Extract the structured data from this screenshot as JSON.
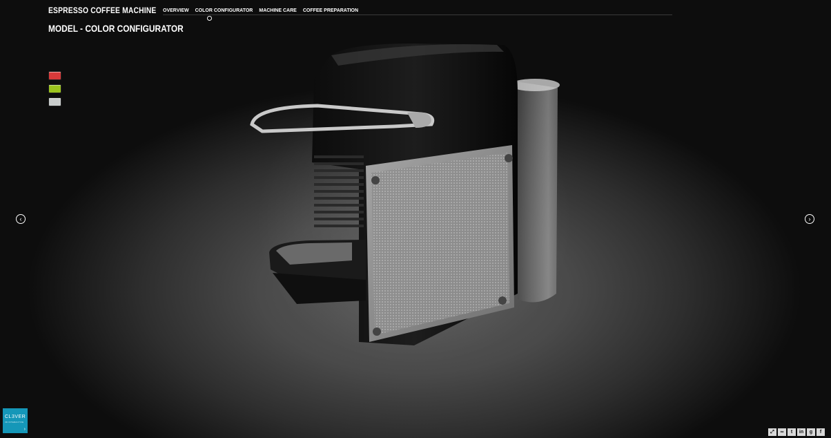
{
  "app": {
    "title": "ESPRESSO COFFEE MACHINE"
  },
  "nav": {
    "items": [
      {
        "label": "OVERVIEW",
        "active": false
      },
      {
        "label": "COLOR CONFIGURATOR",
        "active": true
      },
      {
        "label": "MACHINE CARE",
        "active": false
      },
      {
        "label": "COFFEE PREPARATION",
        "active": false
      }
    ]
  },
  "section": {
    "title": "MODEL - COLOR CONFIGURATOR"
  },
  "swatches": [
    {
      "name": "red",
      "color": "#d83a3a"
    },
    {
      "name": "lime",
      "color": "#9cc41e"
    },
    {
      "name": "silver",
      "color": "#c9cdcc"
    }
  ],
  "arrows": {
    "prev": "‹",
    "next": "›"
  },
  "brand": {
    "name": "CL3VER",
    "tagline": "3D INTERACTIVE",
    "chevron": "›"
  },
  "social": [
    {
      "icon": "fullscreen-icon",
      "glyph": "⤢"
    },
    {
      "icon": "link-icon",
      "glyph": "∞"
    },
    {
      "icon": "twitter-icon",
      "glyph": "t"
    },
    {
      "icon": "linkedin-icon",
      "glyph": "in"
    },
    {
      "icon": "googleplus-icon",
      "glyph": "g"
    },
    {
      "icon": "facebook-icon",
      "glyph": "f"
    }
  ],
  "colors": {
    "background": "#000000",
    "badge": "#1597b8"
  }
}
